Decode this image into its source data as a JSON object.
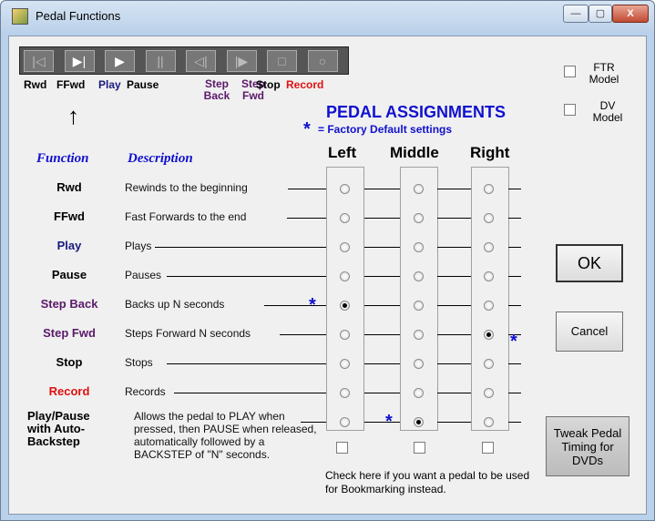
{
  "window": {
    "title": "Pedal Functions",
    "minimize_label": "—",
    "maximize_label": "▢",
    "close_label": "X"
  },
  "transport": {
    "buttons": [
      "|◁",
      "▶|",
      "▶",
      "||",
      "◁|",
      "|▶",
      "□",
      "○"
    ],
    "labels": {
      "rwd": "Rwd",
      "ffwd": "FFwd",
      "play": "Play",
      "pause": "Pause",
      "step_back": "Step Back",
      "step_fwd": "Step Fwd",
      "stop": "Stop",
      "record": "Record"
    },
    "arrow": "↑"
  },
  "options": {
    "ftr_label": "FTR Model",
    "dv_label": "DV Model"
  },
  "assignments": {
    "title": "PEDAL ASSIGNMENTS",
    "star": "*",
    "default_note": "= Factory Default settings",
    "columns": [
      "Left",
      "Middle",
      "Right"
    ]
  },
  "headers": {
    "function": "Function",
    "description": "Description"
  },
  "functions": [
    {
      "name": "Rwd",
      "description": "Rewinds to the beginning",
      "color": "#000000",
      "selected": null
    },
    {
      "name": "FFwd",
      "description": "Fast Forwards to the end",
      "color": "#000000",
      "selected": null
    },
    {
      "name": "Play",
      "description": "Plays",
      "color": "#1a1a80",
      "selected": null
    },
    {
      "name": "Pause",
      "description": "Pauses",
      "color": "#000000",
      "selected": null
    },
    {
      "name": "Step Back",
      "description": "Backs up N seconds",
      "color": "#5a1a6a",
      "selected": "Left"
    },
    {
      "name": "Step Fwd",
      "description": "Steps Forward N seconds",
      "color": "#5a1a6a",
      "selected": "Right"
    },
    {
      "name": "Stop",
      "description": "Stops",
      "color": "#000000",
      "selected": null
    },
    {
      "name": "Record",
      "description": "Records",
      "color": "#e01010",
      "selected": null
    },
    {
      "name": "Play/Pause with Auto-Backstep",
      "description": "Allows the pedal to PLAY when pressed, then PAUSE when released, automatically followed by a BACKSTEP of \"N\" seconds.",
      "color": "#000000",
      "selected": "Middle"
    }
  ],
  "bookmark_note": "Check here if you want a pedal to be used for Bookmarking instead.",
  "buttons": {
    "ok": "OK",
    "cancel": "Cancel",
    "tweak": "Tweak Pedal Timing for DVDs"
  },
  "colors": {
    "accent_blue": "#1010d0",
    "navy": "#1a1a80",
    "purple": "#5a1a6a",
    "record_red": "#e01010"
  }
}
